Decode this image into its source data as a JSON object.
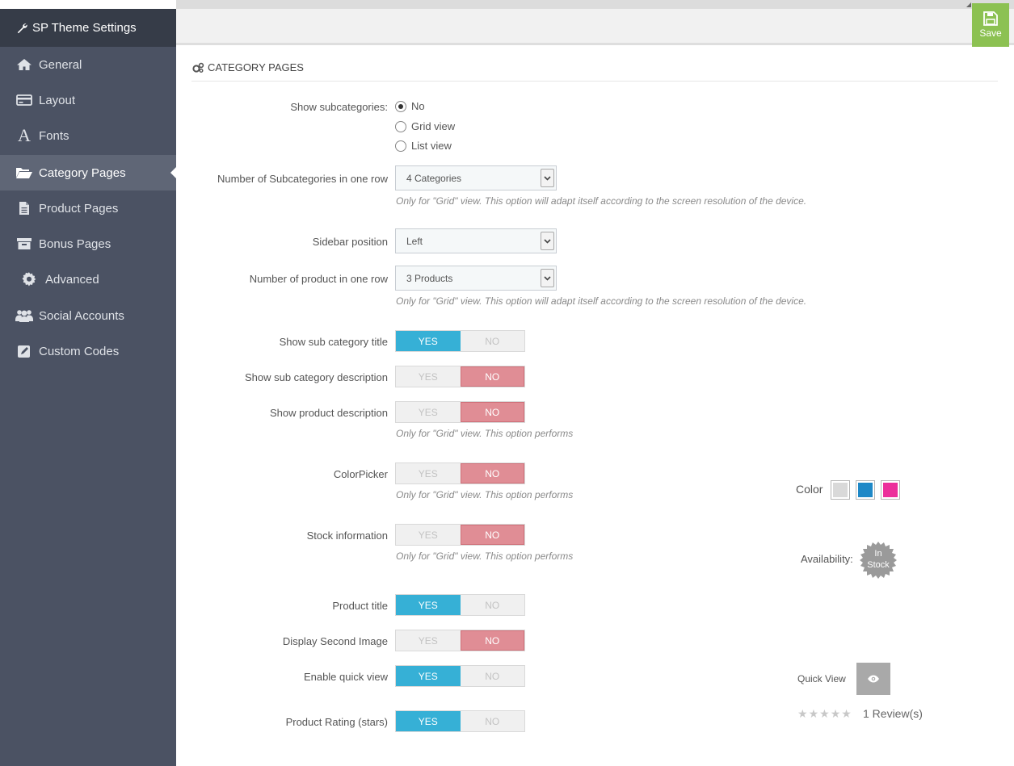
{
  "sidebar": {
    "title": "SP Theme Settings",
    "items": [
      {
        "label": "General",
        "icon": "home-icon"
      },
      {
        "label": "Layout",
        "icon": "credit-card-icon"
      },
      {
        "label": "Fonts",
        "icon": "font-icon"
      },
      {
        "label": "Category Pages",
        "icon": "folder-open-icon",
        "active": true
      },
      {
        "label": "Product Pages",
        "icon": "file-text-icon"
      },
      {
        "label": "Bonus Pages",
        "icon": "archive-icon"
      },
      {
        "label": "Advanced",
        "icon": "gear-icon"
      },
      {
        "label": "Social Accounts",
        "icon": "users-icon"
      },
      {
        "label": "Custom Codes",
        "icon": "edit-icon"
      }
    ]
  },
  "toolbar": {
    "save_label": "Save"
  },
  "section": {
    "title": "CATEGORY PAGES"
  },
  "form": {
    "show_subcategories": {
      "label": "Show subcategories:",
      "options": [
        "No",
        "Grid view",
        "List view"
      ],
      "selected": "No"
    },
    "subcategories_per_row": {
      "label": "Number of Subcategories in one row",
      "value": "4 Categories",
      "help": "Only for \"Grid\" view. This option will adapt itself according to the screen resolution of the device."
    },
    "sidebar_position": {
      "label": "Sidebar position",
      "value": "Left"
    },
    "products_per_row": {
      "label": "Number of product in one row",
      "value": "3 Products",
      "help": "Only for \"Grid\" view. This option will adapt itself according to the screen resolution of the device."
    },
    "toggle_yes": "YES",
    "toggle_no": "NO",
    "show_sub_category_title": {
      "label": "Show sub category title",
      "value": "YES"
    },
    "show_sub_category_description": {
      "label": "Show sub category description",
      "value": "NO"
    },
    "show_product_description": {
      "label": "Show product description",
      "value": "NO",
      "help": "Only for \"Grid\" view. This option performs"
    },
    "color_picker": {
      "label": "ColorPicker",
      "value": "NO",
      "help": "Only for \"Grid\" view. This option performs"
    },
    "stock_information": {
      "label": "Stock information",
      "value": "NO",
      "help": "Only for \"Grid\" view. This option performs"
    },
    "product_title": {
      "label": "Product title",
      "value": "YES"
    },
    "display_second_image": {
      "label": "Display Second Image",
      "value": "NO"
    },
    "enable_quick_view": {
      "label": "Enable quick view",
      "value": "YES"
    },
    "product_rating": {
      "label": "Product Rating (stars)",
      "value": "YES"
    }
  },
  "preview": {
    "color_label": "Color",
    "swatches": [
      "#d9d9d9",
      "#1e88c7",
      "#ec2f9b"
    ],
    "availability_label": "Availability:",
    "stock_line1": "In",
    "stock_line2": "Stock",
    "quick_view_label": "Quick View",
    "rating_stars": 0,
    "reviews": "1 Review(s)"
  },
  "colors": {
    "sidebar": "#4b5263",
    "sidebar_header": "#363c48",
    "yes_active": "#36b0d6",
    "no_active": "#e08d95",
    "save": "#8cc152"
  }
}
